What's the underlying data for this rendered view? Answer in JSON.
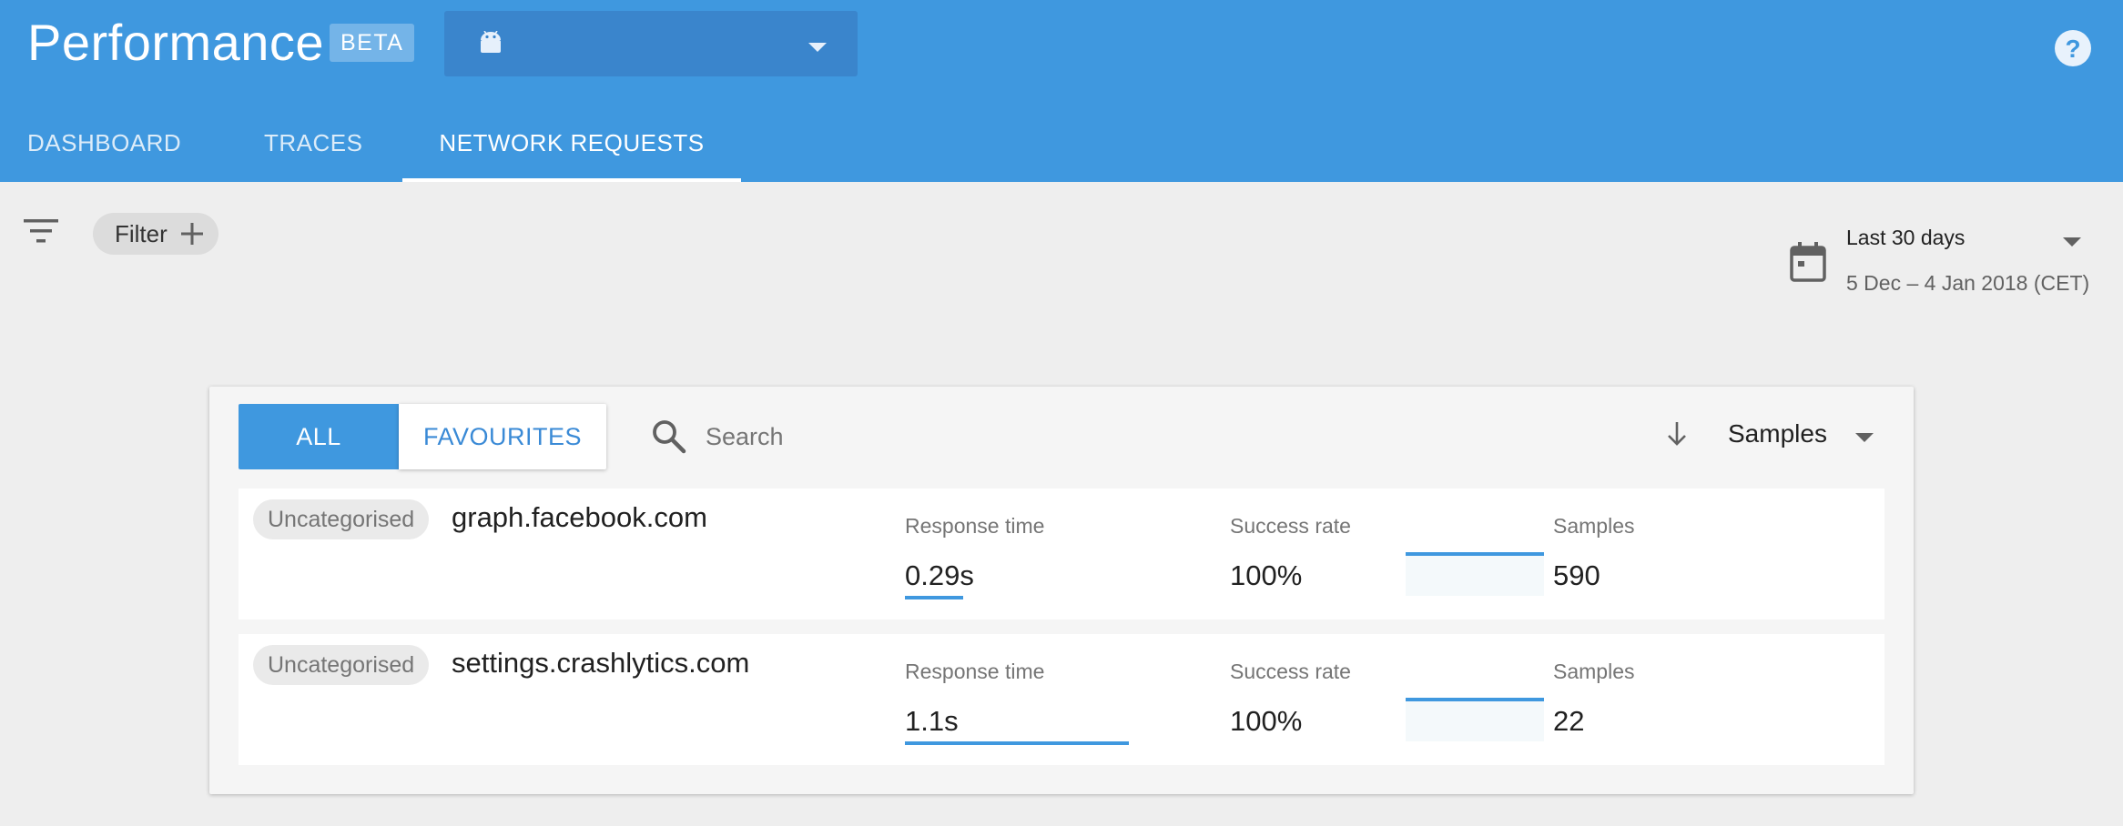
{
  "header": {
    "title": "Performance",
    "badge": "BETA",
    "app_selector_icon": "android-icon",
    "help_icon": "help-icon",
    "colors": {
      "primary": "#3f98df",
      "selector": "#3a85cc"
    }
  },
  "tabs": [
    {
      "label": "DASHBOARD",
      "active": false
    },
    {
      "label": "TRACES",
      "active": false
    },
    {
      "label": "NETWORK REQUESTS",
      "active": true
    }
  ],
  "filters": {
    "chip_label": "Filter",
    "date_range": "Last 30 days",
    "date_sub": "5 Dec – 4 Jan 2018 (CET)"
  },
  "list": {
    "segments": {
      "all": "ALL",
      "favourites": "FAVOURITES",
      "active": "all"
    },
    "search_placeholder": "Search",
    "sort_by": "Samples",
    "rows": [
      {
        "category": "Uncategorised",
        "host": "graph.facebook.com",
        "response_label": "Response time",
        "response_value": "0.29s",
        "response_fraction": 0.26,
        "success_label": "Success rate",
        "success_value": "100%",
        "success_fraction": 1.0,
        "samples_label": "Samples",
        "samples_value": "590"
      },
      {
        "category": "Uncategorised",
        "host": "settings.crashlytics.com",
        "response_label": "Response time",
        "response_value": "1.1s",
        "response_fraction": 1.0,
        "success_label": "Success rate",
        "success_value": "100%",
        "success_fraction": 1.0,
        "samples_label": "Samples",
        "samples_value": "22"
      }
    ]
  }
}
